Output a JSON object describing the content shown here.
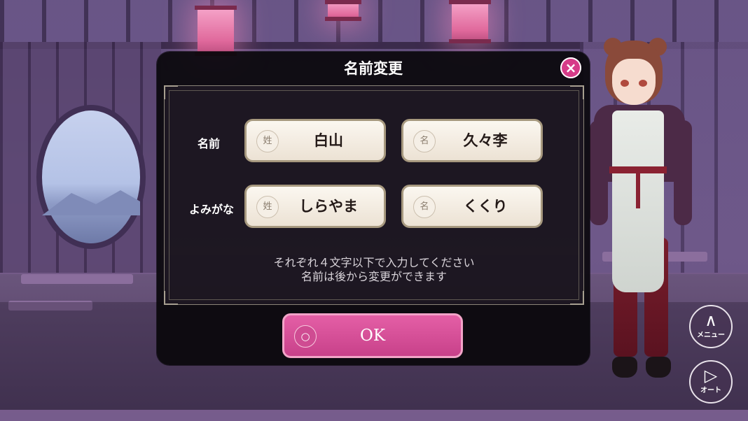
{
  "dialog": {
    "title": "名前変更",
    "close_icon": "×",
    "rows": [
      {
        "label": "名前",
        "fields": [
          {
            "tag": "姓",
            "value": "白山"
          },
          {
            "tag": "名",
            "value": "久々李"
          }
        ]
      },
      {
        "label": "よみがな",
        "fields": [
          {
            "tag": "姓",
            "value": "しらやま"
          },
          {
            "tag": "名",
            "value": "くくり"
          }
        ]
      }
    ],
    "note_line1": "それぞれ４文字以下で入力してください",
    "note_line2": "名前は後から変更ができます",
    "ok_button": {
      "icon": "○",
      "label": "OK"
    },
    "accent_color": "#d63b88"
  },
  "side_buttons": {
    "menu": {
      "icon": "chevron-up-icon",
      "glyph": "∧",
      "label": "メニュー"
    },
    "auto": {
      "icon": "play-icon",
      "glyph": "▷",
      "label": "オート"
    }
  }
}
